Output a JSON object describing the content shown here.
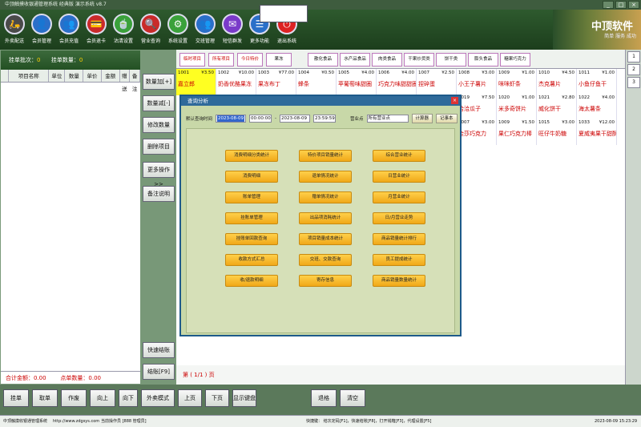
{
  "window": {
    "title": "中顶触摸收银通管理系统 经典版  演示系统 v8.7",
    "controls": [
      "_",
      "□",
      "×"
    ]
  },
  "toolbar": [
    {
      "label": "外卖配送",
      "icon": "delivery-icon",
      "glyph": "🛵",
      "color": "#4a4a4a"
    },
    {
      "label": "会员管理",
      "icon": "member-icon",
      "glyph": "👤",
      "color": "#2a6fc9"
    },
    {
      "label": "会员充值",
      "icon": "recharge-icon",
      "glyph": "👥",
      "color": "#2a6fc9"
    },
    {
      "label": "会员退卡",
      "icon": "card-icon",
      "glyph": "💳",
      "color": "#c92a2a"
    },
    {
      "label": "沽清设置",
      "icon": "sellout-icon",
      "glyph": "🍵",
      "color": "#3aa13a"
    },
    {
      "label": "营业查询",
      "icon": "search-icon",
      "glyph": "🔍",
      "color": "#c92a2a"
    },
    {
      "label": "系统设置",
      "icon": "gear-icon",
      "glyph": "⚙",
      "color": "#3aa13a"
    },
    {
      "label": "交班管理",
      "icon": "shift-icon",
      "glyph": "👥",
      "color": "#2a6fc9"
    },
    {
      "label": "短信群发",
      "icon": "sms-icon",
      "glyph": "✉",
      "color": "#7a3ac9"
    },
    {
      "label": "更多功能",
      "icon": "more-icon",
      "glyph": "☰",
      "color": "#2a6fc9"
    },
    {
      "label": "退出系统",
      "icon": "power-icon",
      "glyph": "⏻",
      "color": "#d22"
    }
  ],
  "brand": {
    "title": "中顶软件",
    "subtitle": "简单 服务 成功"
  },
  "order": {
    "batch_label": "挂单批次：",
    "batch_value": "0",
    "count_label": "挂单数量：",
    "count_value": "0",
    "columns": [
      "",
      "项目名称",
      "单位",
      "数量",
      "单价",
      "金额",
      "赠送",
      "备注"
    ],
    "total_label": "合计金额：",
    "total_value": "0.00",
    "items_label": "点单数量：",
    "items_value": "0.00"
  },
  "side_buttons": [
    "数量加[+]",
    "数量减[-]",
    "修改数量",
    "删除项目",
    "更多操作>>",
    "备注说明",
    "快速结账",
    "结账[F9]"
  ],
  "categories": [
    "临时项目",
    "所有项目",
    "今日特价",
    "果冻",
    "散化食品",
    "水产品食品",
    "肉类食品",
    "干果炒货类",
    "饼干类",
    "膨头食品",
    "糖果巧克力"
  ],
  "products": [
    {
      "code": "1001",
      "price": "¥3.50",
      "name": "嘉立郎"
    },
    {
      "code": "1002",
      "price": "¥10.00",
      "name": "奶香优酪果冻"
    },
    {
      "code": "1003",
      "price": "¥77.00",
      "name": "果冻布丁"
    },
    {
      "code": "1004",
      "price": "¥0.50",
      "name": "蜂条"
    },
    {
      "code": "1005",
      "price": "¥4.00",
      "name": "苹葡萄味甜圈"
    },
    {
      "code": "1006",
      "price": "¥4.00",
      "name": "巧克力味甜甜圈"
    },
    {
      "code": "1007",
      "price": "¥2.50",
      "name": "捏碎蛋"
    },
    {
      "code": "1008",
      "price": "¥3.00",
      "name": "小王子薯片"
    },
    {
      "code": "1009",
      "price": "¥1.00",
      "name": "咪咪虾条"
    },
    {
      "code": "1010",
      "price": "¥4.50",
      "name": "杰克薯片"
    },
    {
      "code": "1011",
      "price": "¥1.00",
      "name": "小鱼仔鱼干"
    },
    {
      "code": "1019",
      "price": "¥7.50",
      "name": "洽洽瓜子"
    },
    {
      "code": "1020",
      "price": "¥1.00",
      "name": "米多奇饼片"
    },
    {
      "code": "1021",
      "price": "¥2.80",
      "name": "威化饼干"
    },
    {
      "code": "1022",
      "price": "¥4.00",
      "name": "海太薯条"
    },
    {
      "code": "1007",
      "price": "¥3.00",
      "name": "金莎巧克力"
    },
    {
      "code": "1009",
      "price": "¥1.50",
      "name": "果仁巧克力棒"
    },
    {
      "code": "1015",
      "price": "¥3.00",
      "name": "旺仔牛奶糖"
    },
    {
      "code": "1033",
      "price": "¥12.00",
      "name": "夏威夷果干甜酥"
    }
  ],
  "pager": {
    "text": "第 ( 1/1 ) 页"
  },
  "right_bar": [
    "1",
    "2",
    "3"
  ],
  "bottom_buttons": [
    "挂单",
    "取单",
    "作废",
    "向上",
    "向下",
    "外卖模式",
    "上页",
    "下页",
    "显示键盘",
    "退格",
    "清空"
  ],
  "status": {
    "company": "中顶触摸收银通管理系统",
    "url": "http://www.zdgsys.com",
    "operator": "当前操作员 [888 管理员]",
    "hotkeys": "快捷键：  结次定码[F1]，快速结账[F8]，打开钱箱[F3]，代理设置[F5]",
    "datetime": "2023-08-09 15:23:29"
  },
  "dialog": {
    "title": "查询分析",
    "close": "×",
    "filter": {
      "time_label": "默认查询时间",
      "date_from": "2023-08-09",
      "time_from": "00:00:00",
      "sep": "-",
      "date_to": "2023-08-09",
      "time_to": "23:59:59",
      "store_label": "营业点",
      "store_value": "所有营业点",
      "btn_calc": "计算器",
      "btn_note": "记事本"
    },
    "buttons": [
      "消费明细分类统计",
      "特价项目销量统计",
      "综合营业统计",
      "消费明细",
      "退单情况统计",
      "日营业统计",
      "账单管理",
      "赠单情况统计",
      "月营业统计",
      "挂账单管理",
      "出品项消耗统计",
      "日/月营业走势",
      "挂账单回款查询",
      "项目销量成本统计",
      "商品销量统计排行",
      "收款方式汇总",
      "交班、交款查询",
      "员工提成统计",
      "收/退款明细",
      "寄存信息",
      "商品销量数量统计"
    ]
  },
  "colors": {
    "accent": "#ffd200",
    "dialog_title": "#2f6a9a",
    "dialog_button": "#f0a818",
    "category_active": "#cc0000"
  }
}
